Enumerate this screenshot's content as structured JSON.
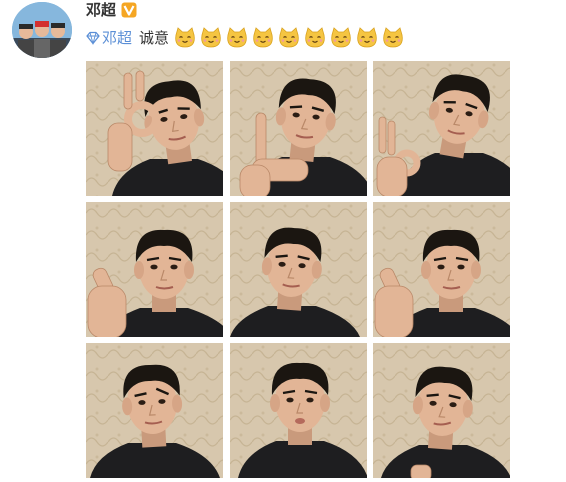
{
  "post": {
    "author_name": "邓超",
    "mention_name": "邓超",
    "text": "诚意",
    "emoji_names": [
      "cat-emoji",
      "cat-emoji",
      "cat-emoji",
      "cat-emoji",
      "cat-emoji",
      "cat-emoji",
      "cat-emoji",
      "cat-emoji",
      "cat-emoji"
    ]
  },
  "colors": {
    "mention": "#5b8fd6",
    "verified_badge": "#f5a623",
    "emoji": "#f5c542",
    "wall": "#d7c7ad",
    "hoodie": "#1e1e20",
    "skin": "#e2b596",
    "hair": "#1b1611"
  },
  "photos": [
    {
      "gesture": "ok-over-eye"
    },
    {
      "gesture": "l-hand-chin"
    },
    {
      "gesture": "ok-sign"
    },
    {
      "gesture": "finger-heart"
    },
    {
      "gesture": "side-look"
    },
    {
      "gesture": "finger-heart"
    },
    {
      "gesture": "raised-brow"
    },
    {
      "gesture": "pout"
    },
    {
      "gesture": "smirk"
    }
  ]
}
